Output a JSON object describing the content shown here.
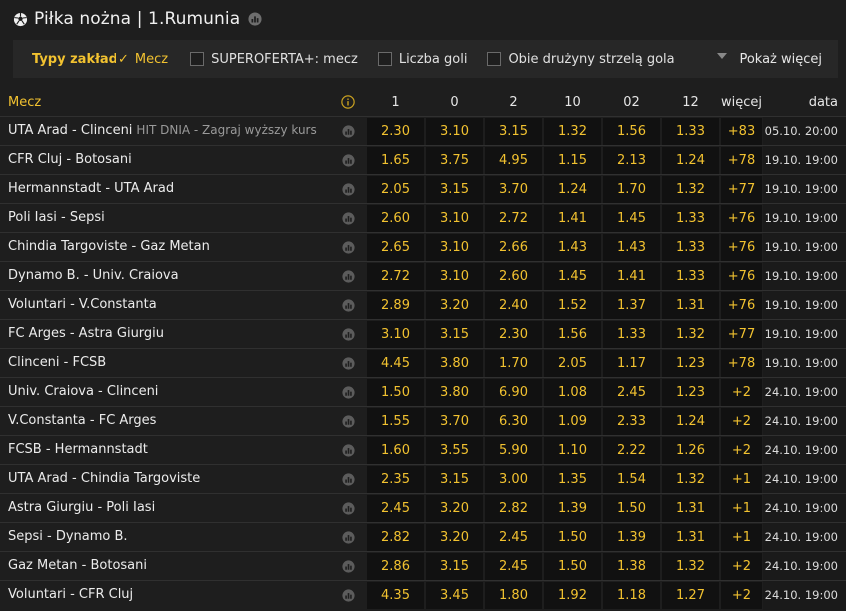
{
  "header": {
    "title": "Piłka nożna | 1.Rumunia"
  },
  "filters": {
    "label": "Typy zakładów",
    "check": "✓",
    "active": "Mecz",
    "items": [
      "SUPEROFERTA+: mecz",
      "Liczba goli",
      "Obie drużyny strzelą gola"
    ],
    "more": "Pokaż więcej"
  },
  "columns": {
    "match": "Mecz",
    "odds": [
      "1",
      "0",
      "2",
      "10",
      "02",
      "12"
    ],
    "more": "więcej",
    "date": "data"
  },
  "rows": [
    {
      "name": "UTA Arad - Clinceni",
      "promo": "HIT DNIA - Zagraj wyższy kurs",
      "odds": [
        "2.30",
        "3.10",
        "3.15",
        "1.32",
        "1.56",
        "1.33"
      ],
      "more": "+83",
      "date": "05.10. 20:00"
    },
    {
      "name": "CFR Cluj - Botosani",
      "promo": "",
      "odds": [
        "1.65",
        "3.75",
        "4.95",
        "1.15",
        "2.13",
        "1.24"
      ],
      "more": "+78",
      "date": "19.10. 19:00"
    },
    {
      "name": "Hermannstadt - UTA Arad",
      "promo": "",
      "odds": [
        "2.05",
        "3.15",
        "3.70",
        "1.24",
        "1.70",
        "1.32"
      ],
      "more": "+77",
      "date": "19.10. 19:00"
    },
    {
      "name": "Poli Iasi - Sepsi",
      "promo": "",
      "odds": [
        "2.60",
        "3.10",
        "2.72",
        "1.41",
        "1.45",
        "1.33"
      ],
      "more": "+76",
      "date": "19.10. 19:00"
    },
    {
      "name": "Chindia Targoviste - Gaz Metan",
      "promo": "",
      "odds": [
        "2.65",
        "3.10",
        "2.66",
        "1.43",
        "1.43",
        "1.33"
      ],
      "more": "+76",
      "date": "19.10. 19:00"
    },
    {
      "name": "Dynamo B. - Univ. Craiova",
      "promo": "",
      "odds": [
        "2.72",
        "3.10",
        "2.60",
        "1.45",
        "1.41",
        "1.33"
      ],
      "more": "+76",
      "date": "19.10. 19:00"
    },
    {
      "name": "Voluntari - V.Constanta",
      "promo": "",
      "odds": [
        "2.89",
        "3.20",
        "2.40",
        "1.52",
        "1.37",
        "1.31"
      ],
      "more": "+76",
      "date": "19.10. 19:00"
    },
    {
      "name": "FC Arges - Astra Giurgiu",
      "promo": "",
      "odds": [
        "3.10",
        "3.15",
        "2.30",
        "1.56",
        "1.33",
        "1.32"
      ],
      "more": "+77",
      "date": "19.10. 19:00"
    },
    {
      "name": "Clinceni - FCSB",
      "promo": "",
      "odds": [
        "4.45",
        "3.80",
        "1.70",
        "2.05",
        "1.17",
        "1.23"
      ],
      "more": "+78",
      "date": "19.10. 19:00"
    },
    {
      "name": "Univ. Craiova - Clinceni",
      "promo": "",
      "odds": [
        "1.50",
        "3.80",
        "6.90",
        "1.08",
        "2.45",
        "1.23"
      ],
      "more": "+2",
      "date": "24.10. 19:00"
    },
    {
      "name": "V.Constanta - FC Arges",
      "promo": "",
      "odds": [
        "1.55",
        "3.70",
        "6.30",
        "1.09",
        "2.33",
        "1.24"
      ],
      "more": "+2",
      "date": "24.10. 19:00"
    },
    {
      "name": "FCSB - Hermannstadt",
      "promo": "",
      "odds": [
        "1.60",
        "3.55",
        "5.90",
        "1.10",
        "2.22",
        "1.26"
      ],
      "more": "+2",
      "date": "24.10. 19:00"
    },
    {
      "name": "UTA Arad - Chindia Targoviste",
      "promo": "",
      "odds": [
        "2.35",
        "3.15",
        "3.00",
        "1.35",
        "1.54",
        "1.32"
      ],
      "more": "+1",
      "date": "24.10. 19:00"
    },
    {
      "name": "Astra Giurgiu - Poli Iasi",
      "promo": "",
      "odds": [
        "2.45",
        "3.20",
        "2.82",
        "1.39",
        "1.50",
        "1.31"
      ],
      "more": "+1",
      "date": "24.10. 19:00"
    },
    {
      "name": "Sepsi - Dynamo B.",
      "promo": "",
      "odds": [
        "2.82",
        "3.20",
        "2.45",
        "1.50",
        "1.39",
        "1.31"
      ],
      "more": "+1",
      "date": "24.10. 19:00"
    },
    {
      "name": "Gaz Metan - Botosani",
      "promo": "",
      "odds": [
        "2.86",
        "3.15",
        "2.45",
        "1.50",
        "1.38",
        "1.32"
      ],
      "more": "+2",
      "date": "24.10. 19:00"
    },
    {
      "name": "Voluntari - CFR Cluj",
      "promo": "",
      "odds": [
        "4.35",
        "3.45",
        "1.80",
        "1.92",
        "1.18",
        "1.27"
      ],
      "more": "+2",
      "date": "24.10. 19:00"
    }
  ]
}
